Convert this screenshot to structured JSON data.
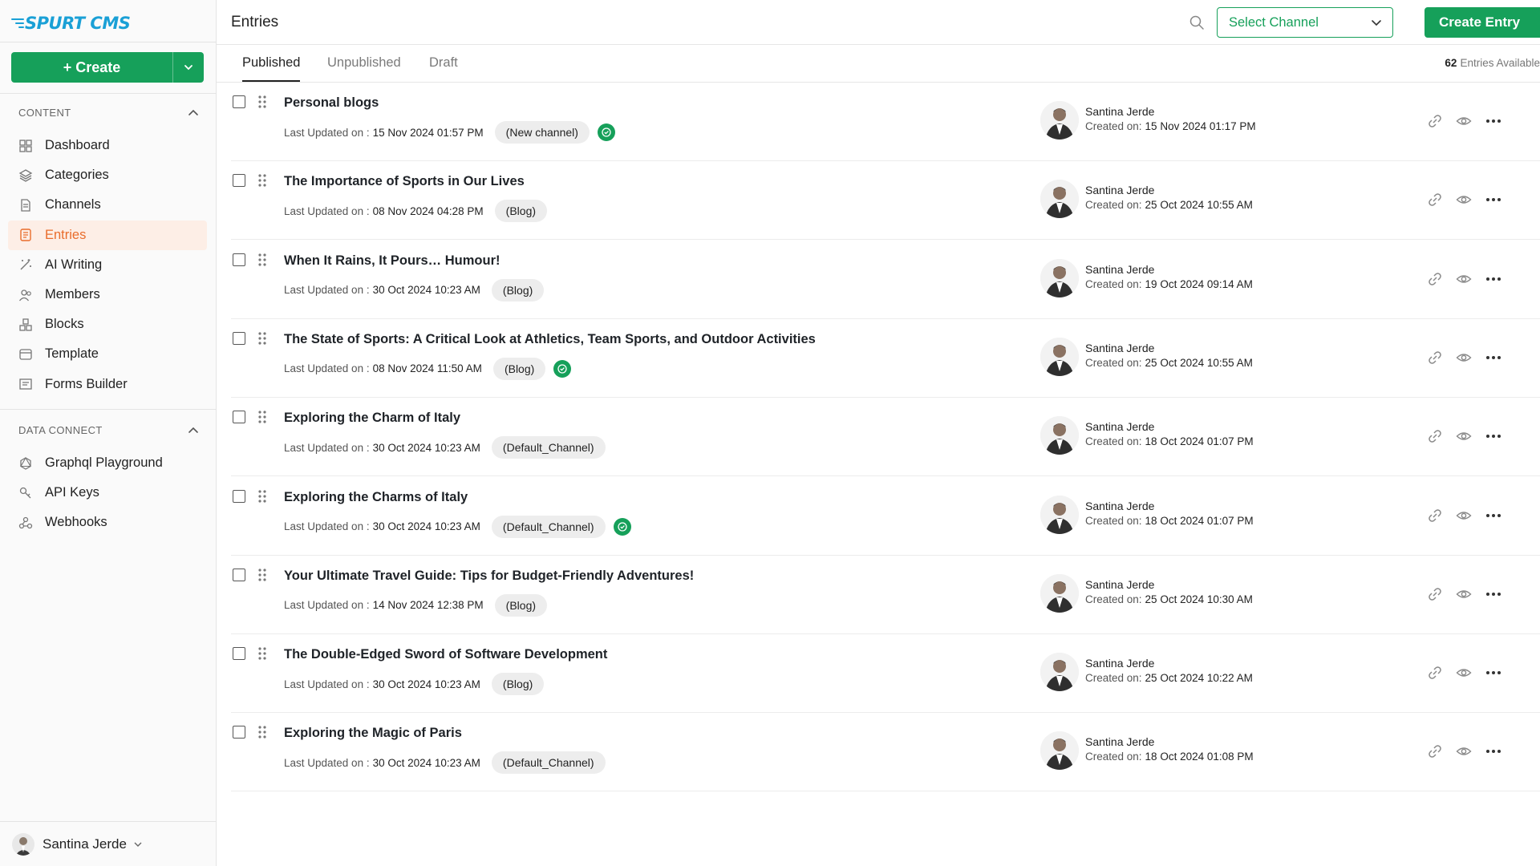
{
  "app": {
    "logo": "SPURT CMS"
  },
  "sidebar": {
    "create_label": "+ Create",
    "sections": [
      {
        "title": "CONTENT"
      },
      {
        "title": "DATA CONNECT"
      }
    ],
    "content_items": [
      {
        "label": "Dashboard",
        "icon": "grid-icon"
      },
      {
        "label": "Categories",
        "icon": "layers-icon"
      },
      {
        "label": "Channels",
        "icon": "document-icon"
      },
      {
        "label": "Entries",
        "icon": "list-doc-icon",
        "active": true
      },
      {
        "label": "AI Writing",
        "icon": "magic-wand-icon"
      },
      {
        "label": "Members",
        "icon": "users-icon"
      },
      {
        "label": "Blocks",
        "icon": "blocks-icon"
      },
      {
        "label": "Template",
        "icon": "template-icon"
      },
      {
        "label": "Forms Builder",
        "icon": "form-icon"
      }
    ],
    "data_items": [
      {
        "label": "Graphql Playground",
        "icon": "graphql-icon"
      },
      {
        "label": "API Keys",
        "icon": "key-icon"
      },
      {
        "label": "Webhooks",
        "icon": "webhook-icon"
      }
    ],
    "user_name": "Santina Jerde"
  },
  "header": {
    "title": "Entries",
    "channel_placeholder": "Select Channel",
    "create_entry_label": "Create Entry"
  },
  "tabs": [
    {
      "label": "Published",
      "active": true
    },
    {
      "label": "Unpublished"
    },
    {
      "label": "Draft"
    }
  ],
  "count": {
    "number": "62",
    "label": "Entries Available"
  },
  "entry_labels": {
    "updated_prefix": "Last Updated on :",
    "created_prefix": "Created on:"
  },
  "entries": [
    {
      "title": "Personal blogs",
      "updated": "15 Nov 2024 01:57 PM",
      "channel": "(New channel)",
      "badge": true,
      "author": "Santina Jerde",
      "created": "15 Nov 2024 01:17 PM"
    },
    {
      "title": "The Importance of Sports in Our Lives",
      "updated": "08 Nov 2024 04:28 PM",
      "channel": "(Blog)",
      "badge": false,
      "author": "Santina Jerde",
      "created": "25 Oct 2024 10:55 AM"
    },
    {
      "title": "When It Rains, It Pours… Humour!",
      "updated": "30 Oct 2024 10:23 AM",
      "channel": "(Blog)",
      "badge": false,
      "author": "Santina Jerde",
      "created": "19 Oct 2024 09:14 AM"
    },
    {
      "title": "The State of Sports: A Critical Look at Athletics, Team Sports, and Outdoor Activities",
      "updated": "08 Nov 2024 11:50 AM",
      "channel": "(Blog)",
      "badge": true,
      "author": "Santina Jerde",
      "created": "25 Oct 2024 10:55 AM"
    },
    {
      "title": "Exploring the Charm of Italy",
      "updated": "30 Oct 2024 10:23 AM",
      "channel": "(Default_Channel)",
      "badge": false,
      "author": "Santina Jerde",
      "created": "18 Oct 2024 01:07 PM"
    },
    {
      "title": "Exploring the Charms of Italy",
      "updated": "30 Oct 2024 10:23 AM",
      "channel": "(Default_Channel)",
      "badge": true,
      "author": "Santina Jerde",
      "created": "18 Oct 2024 01:07 PM"
    },
    {
      "title": "Your Ultimate Travel Guide: Tips for Budget-Friendly Adventures!",
      "updated": "14 Nov 2024 12:38 PM",
      "channel": "(Blog)",
      "badge": false,
      "author": "Santina Jerde",
      "created": "25 Oct 2024 10:30 AM"
    },
    {
      "title": "The Double-Edged Sword of Software Development",
      "updated": "30 Oct 2024 10:23 AM",
      "channel": "(Blog)",
      "badge": false,
      "author": "Santina Jerde",
      "created": "25 Oct 2024 10:22 AM"
    },
    {
      "title": "Exploring the Magic of Paris",
      "updated": "30 Oct 2024 10:23 AM",
      "channel": "(Default_Channel)",
      "badge": false,
      "author": "Santina Jerde",
      "created": "18 Oct 2024 01:08 PM"
    }
  ],
  "colors": {
    "accent": "#16a05a",
    "active_nav": "#e96d2c",
    "logo": "#1aa0d6"
  }
}
